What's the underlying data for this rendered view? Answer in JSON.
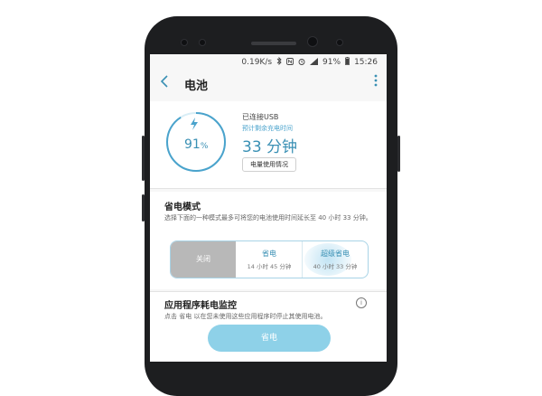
{
  "status_bar": {
    "speed": "0.19K/s",
    "bluetooth_icon": "bluetooth-icon",
    "nfc_icon": "nfc-icon",
    "alarm_icon": "alarm-icon",
    "battery": "91%",
    "time": "15:26"
  },
  "app_bar": {
    "back_icon": "back-arrow-icon",
    "title": "电池",
    "more_icon": "more-vert-icon"
  },
  "battery_card": {
    "percent": "91",
    "percent_unit": "%",
    "level": 0.91,
    "bolt_icon": "charging-bolt-icon",
    "connection": "已连接USB",
    "remaining_label": "预计剩余充电时间",
    "remaining_time": "33 分钟",
    "usage_button": "电量使用情况"
  },
  "power_saving": {
    "title": "省电模式",
    "description": "选择下面的一种模式最多可将您的电池使用时间延长至 40 小时 33 分钟。",
    "options": [
      {
        "name": "关闭",
        "sub": ""
      },
      {
        "name": "省电",
        "sub": "14 小时 45 分钟"
      },
      {
        "name": "超级省电",
        "sub": "40 小时 33 分钟"
      }
    ]
  },
  "app_monitor": {
    "title": "应用程序耗电监控",
    "info_icon": "info-icon",
    "description": "点击 省电 以在您未使用这些应用程序时停止其使用电池。",
    "save_button": "省电"
  },
  "colors": {
    "accent": "#3a90b4",
    "accent_light": "#8ed1e8",
    "frame": "#1d1e20"
  }
}
